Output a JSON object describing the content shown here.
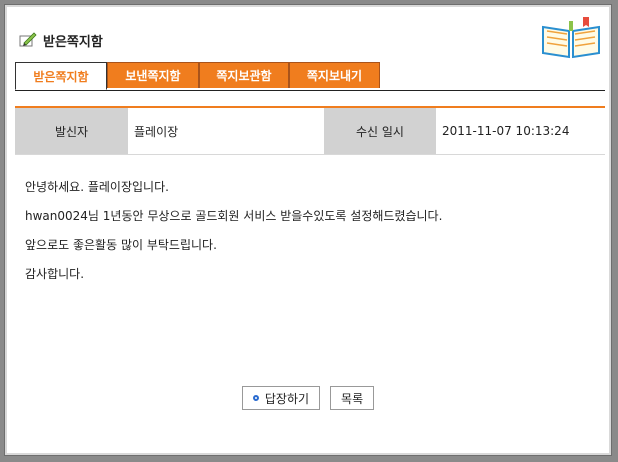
{
  "header": {
    "title": "받은쪽지함"
  },
  "tabs": [
    {
      "label": "받은쪽지함",
      "active": true
    },
    {
      "label": "보낸쪽지함",
      "active": false
    },
    {
      "label": "쪽지보관함",
      "active": false
    },
    {
      "label": "쪽지보내기",
      "active": false
    }
  ],
  "info": {
    "sender_label": "발신자",
    "sender_value": "플레이장",
    "date_label": "수신 일시",
    "date_value": "2011-11-07 10:13:24"
  },
  "message": {
    "lines": [
      "안녕하세요. 플레이장입니다.",
      "hwan0024님 1년동안 무상으로 골드회원 서비스 받을수있도록 설정해드렸습니다.",
      "앞으로도 좋은활동 많이 부탁드립니다.",
      "감사합니다."
    ]
  },
  "buttons": {
    "reply": "답장하기",
    "list": "목록"
  },
  "colors": {
    "accent": "#f07d1e",
    "label_bg": "#d2d2d2"
  }
}
